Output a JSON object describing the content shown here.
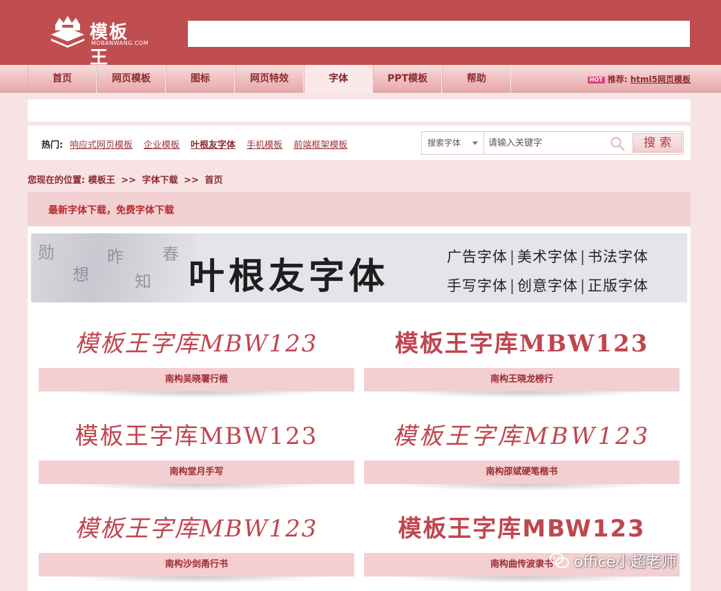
{
  "header": {
    "logo_text": "模板王",
    "logo_sub": "MOBANWANG.COM"
  },
  "nav": {
    "items": [
      {
        "label": "首页"
      },
      {
        "label": "网页模板"
      },
      {
        "label": "图标"
      },
      {
        "label": "网页特效"
      },
      {
        "label": "字体",
        "active": true
      },
      {
        "label": "PPT模板"
      },
      {
        "label": "帮助"
      }
    ],
    "hot_badge": "HOT",
    "recommend_label": "推荐:",
    "recommend_link": "html5网页模板"
  },
  "hot": {
    "label": "热门:",
    "links": [
      "响应式网页模板",
      "企业模板",
      "叶根友字体",
      "手机模板",
      "前端框架模板"
    ]
  },
  "search": {
    "category": "搜索字体",
    "placeholder": "请输入关键字",
    "button": "搜索"
  },
  "breadcrumb": {
    "prefix": "您现在的位置:",
    "items": [
      "模板王",
      "字体下载",
      "首页"
    ],
    "separator": ">>"
  },
  "page_title": "最新字体下载，免费字体下载",
  "banner": {
    "title": "叶根友字体",
    "row1": [
      "广告字体",
      "美术字体",
      "书法字体"
    ],
    "row2": [
      "手写字体",
      "创意字体",
      "正版字体"
    ]
  },
  "fonts": [
    {
      "sample": "模板王字库MBW123",
      "name": "南构吴晓署行楷"
    },
    {
      "sample": "模板王字库MBW123",
      "name": "南构王晓龙榜行"
    },
    {
      "sample": "模板王字库MBW123",
      "name": "南构堂月手写"
    },
    {
      "sample": "模板王字库MBW123",
      "name": "南构邵斌硬笔楷书"
    },
    {
      "sample": "模板王字库MBW123",
      "name": "南构沙剑甬行书"
    },
    {
      "sample": "模板王字库MBW123",
      "name": "南构曲传波隶书"
    }
  ],
  "watermark": "office小超老师",
  "colors": {
    "brand": "#c04e50",
    "accent": "#b42b30",
    "background": "#f7e3e3"
  }
}
